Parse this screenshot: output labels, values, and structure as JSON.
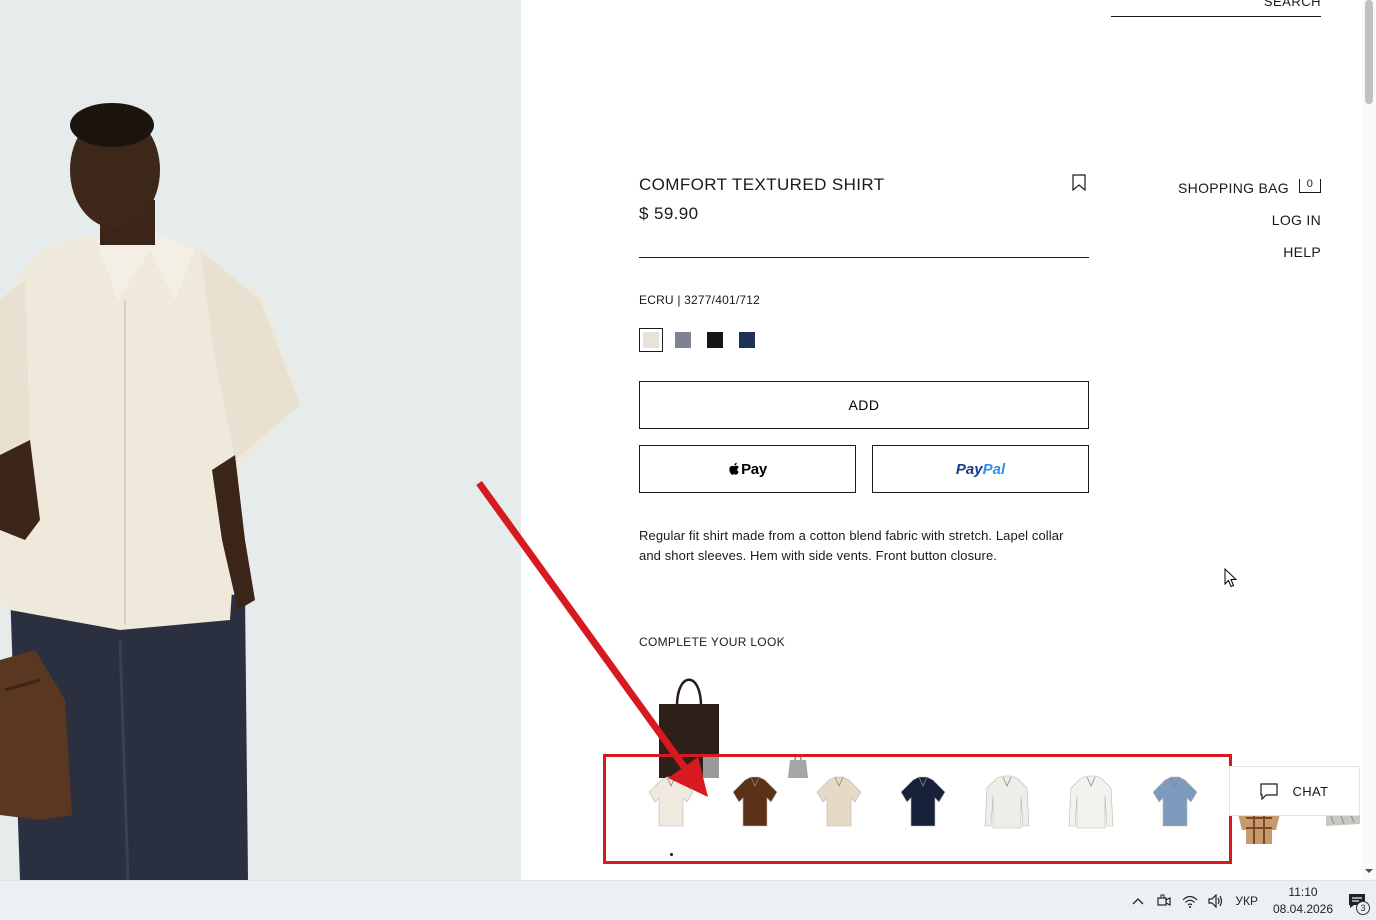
{
  "header": {
    "search_label": "SEARCH",
    "nav": {
      "shopping_bag_label": "SHOPPING BAG",
      "bag_count": "0",
      "login_label": "LOG IN",
      "help_label": "HELP"
    }
  },
  "product": {
    "title": "COMFORT TEXTURED SHIRT",
    "price": "$ 59.90",
    "color_reference": "ECRU | 3277/401/712",
    "swatches": [
      {
        "name": "ecru",
        "color": "#e8e2d8",
        "selected": true
      },
      {
        "name": "blue-grey",
        "color": "#7d8294",
        "selected": false
      },
      {
        "name": "black",
        "color": "#161616",
        "selected": false
      },
      {
        "name": "navy",
        "color": "#1f3157",
        "selected": false
      }
    ],
    "add_label": "ADD",
    "apple_pay_label": "Pay",
    "paypal_label_a": "Pay",
    "paypal_label_b": "Pal",
    "description": "Regular fit shirt made from a cotton blend fabric with stretch. Lapel collar and short sleeves. Hem with side vents. Front button closure."
  },
  "complete_your_look": {
    "heading": "COMPLETE YOUR LOOK"
  },
  "carousel": {
    "items": [
      {
        "name": "ecru-short-sleeve-shirt",
        "color": "#efe9df"
      },
      {
        "name": "brown-short-sleeve-shirt",
        "color": "#5b3218"
      },
      {
        "name": "beige-short-sleeve-shirt",
        "color": "#e6d9c6"
      },
      {
        "name": "navy-polo-shirt",
        "color": "#17223a"
      },
      {
        "name": "white-long-sleeve-shirt",
        "color": "#efede8"
      },
      {
        "name": "white-long-sleeve-shirt-2",
        "color": "#f3f2ee"
      },
      {
        "name": "blue-check-shirt",
        "color": "#7d9bbd"
      }
    ]
  },
  "chat": {
    "label": "CHAT"
  },
  "annotation": {
    "arrow_color": "#d71920"
  },
  "taskbar": {
    "language": "УКР",
    "time": "11:10",
    "date": "08.04.2026",
    "notification_count": "3"
  }
}
